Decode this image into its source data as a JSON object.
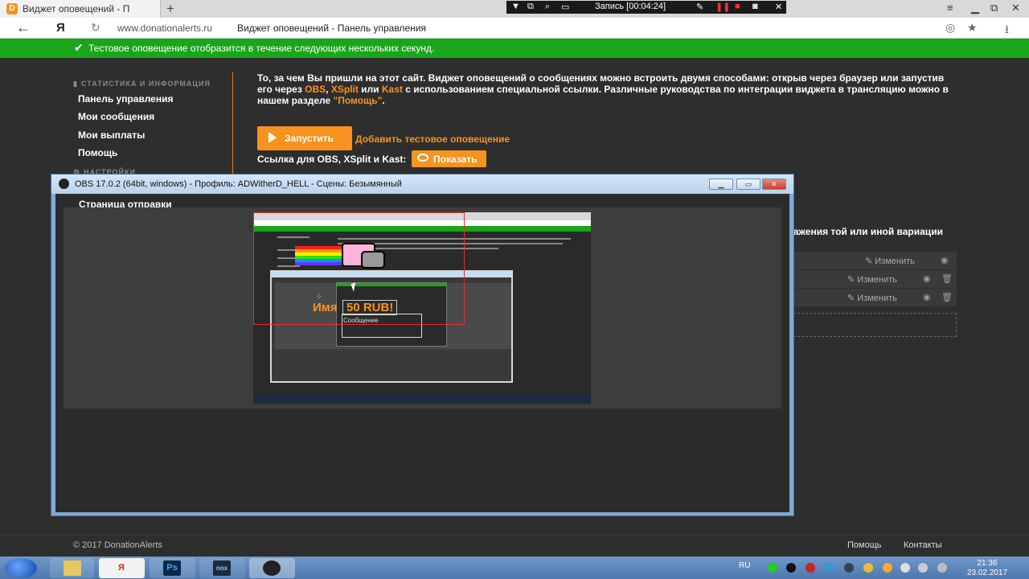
{
  "browser": {
    "tab_title": "Виджет оповещений - П",
    "favicon_letter": "D",
    "new_tab": "+",
    "domain": "www.donationalerts.ru",
    "page_title": "Виджет оповещений - Панель управления",
    "yandex_letter": "Я",
    "recording": "Запись [00:04:24]"
  },
  "notice": {
    "text": "Тестовое оповещение отобразится в течение следующих нескольких секунд."
  },
  "sidebar": {
    "section_stats": "СТАТИСТИКА И ИНФОРМАЦИЯ",
    "items": [
      "Панель управления",
      "Мои сообщения",
      "Мои выплаты",
      "Помощь"
    ],
    "section_settings": "НАСТРОЙКИ",
    "send_page": "Страница отправки"
  },
  "main": {
    "intro_part1": "То, за чем Вы пришли на этот сайт. Виджет оповещений о сообщениях можно встроить двумя способами: открыв через браузер или запустив его через ",
    "obs": "OBS",
    "comma": ", ",
    "xsplit": "XSplit",
    "or": " или ",
    "kast": "Kast",
    "intro_part2": " с использованием специальной ссылки. Различные руководства по интеграции виджета в трансляцию можно в нашем разделе ",
    "help_link": "\"Помощь\"",
    "period": ".",
    "run_button": "Запустить",
    "test_link": "Добавить тестовое оповещение",
    "link_label": "Ссылка для OBS, XSplit и Kast:",
    "show_button": "Показать",
    "variation_text": "бражения той или иной вариации",
    "edit_label": "Изменить"
  },
  "obs_window": {
    "title": "OBS 17.0.2 (64bit, windows) - Профиль: ADWitherD_HELL - Сцены: Безымянный",
    "preview_alert_name": "Имя",
    "preview_alert_amount": "50 RUB!",
    "preview_alert_message": "Сообщение"
  },
  "footer": {
    "copyright": "© 2017 DonationAlerts",
    "help": "Помощь",
    "contacts": "Контакты"
  },
  "taskbar": {
    "ps_label": "Ps",
    "nox_label": "nox",
    "lang": "RU",
    "time": "21:36",
    "date": "23.02.2017"
  },
  "colors": {
    "accent": "#f7931e",
    "notice_green": "#1aa61a",
    "background": "#2e2e2e"
  }
}
